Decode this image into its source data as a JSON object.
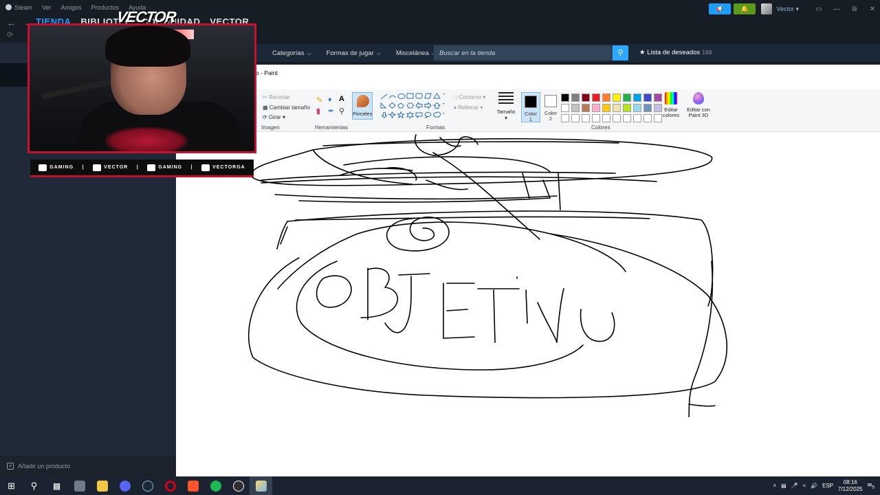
{
  "steam": {
    "menu": [
      "Steam",
      "Ver",
      "Amigos",
      "Productos",
      "Ayuda"
    ],
    "nav": [
      "TIENDA",
      "BIBLIOTEC",
      "COMUNIDAD",
      "VECTOR"
    ],
    "username": "Vector",
    "store_nav": [
      "Categorías",
      "Formas de jugar",
      "Miscelánea"
    ],
    "search_placeholder": "Buscar en la tienda",
    "wishlist_label": "Lista de deseados",
    "wishlist_count": "168",
    "add_product": "Añadir un producto",
    "accent_color": "#1a9fff"
  },
  "paint": {
    "title": "o - Paint",
    "imagen": {
      "recortar": "Recortar",
      "cambiar": "Cambiar tamaño",
      "girar": "Girar",
      "label": "Imagen"
    },
    "herramientas_label": "Herramientas",
    "pinceles": "Pinceles",
    "formas": {
      "contorno": "Contorno",
      "rellenar": "Rellenar",
      "label": "Formas"
    },
    "tamano": "Tamaño",
    "color1": [
      "Color",
      "1"
    ],
    "color2": [
      "Color",
      "2"
    ],
    "colores_label": "Colores",
    "editar_colores": [
      "Editar",
      "colores"
    ],
    "editar_3d": [
      "Editar con",
      "Paint 3D"
    ],
    "palette": [
      "#000000",
      "#7f7f7f",
      "#880015",
      "#ed1c24",
      "#ff7f27",
      "#fff200",
      "#22b14c",
      "#00a2e8",
      "#3f48cc",
      "#a349a4",
      "#ffffff",
      "#c3c3c3",
      "#b97a57",
      "#ffaec9",
      "#ffc90e",
      "#efe4b0",
      "#b5e61d",
      "#99d9ea",
      "#7092be",
      "#c8bfe7",
      "#ffffff",
      "#ffffff",
      "#ffffff",
      "#ffffff",
      "#ffffff",
      "#ffffff",
      "#ffffff",
      "#ffffff",
      "#ffffff",
      "#ffffff"
    ]
  },
  "overlay": {
    "logo": "VECTOR",
    "socials": [
      {
        "icon": "youtube-icon",
        "text": "GAMING"
      },
      {
        "icon": "twitch-icon",
        "text": "VECTOR"
      },
      {
        "icon": "twitter-icon",
        "text": "GAMING"
      },
      {
        "icon": "instagram-icon",
        "text": "VECTORGA"
      }
    ]
  },
  "taskbar": {
    "lang": "ESP",
    "time": "08:16",
    "date": "7/12/2025",
    "notif_count": "5"
  }
}
